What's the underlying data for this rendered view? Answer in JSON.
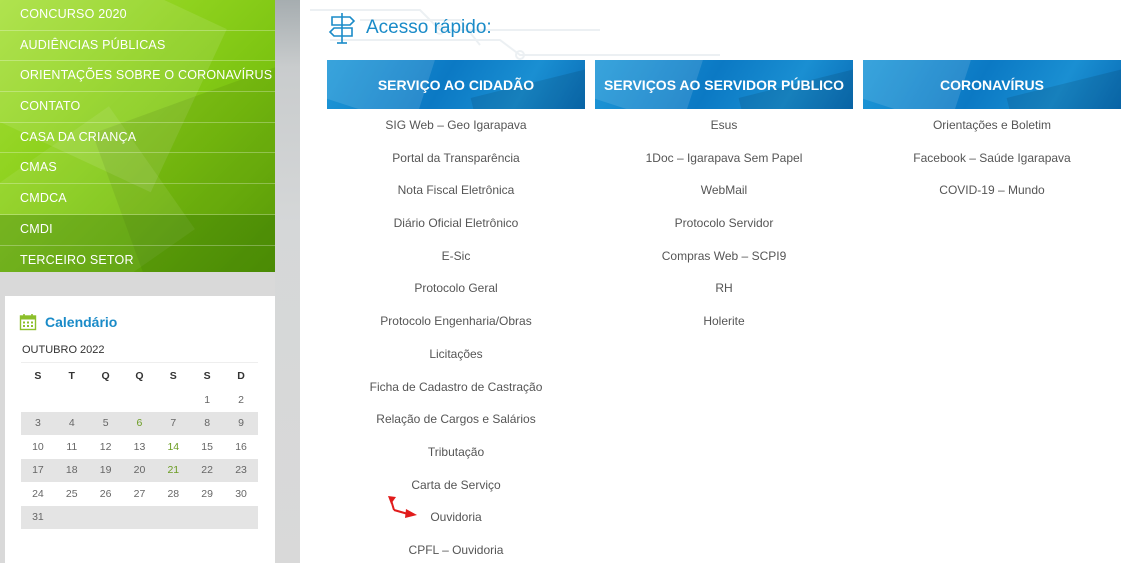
{
  "sidebar": {
    "menu": [
      {
        "label": "CONCURSO 2020"
      },
      {
        "label": "AUDIÊNCIAS PÚBLICAS"
      },
      {
        "label": "ORIENTAÇÕES SOBRE O CORONAVÍRUS"
      },
      {
        "label": "CONTATO"
      },
      {
        "label": "CASA DA CRIANÇA"
      },
      {
        "label": "CMAS"
      },
      {
        "label": "CMDCA"
      },
      {
        "label": "CMDI"
      },
      {
        "label": "TERCEIRO SETOR"
      }
    ],
    "calendar": {
      "title": "Calendário",
      "month": "OUTUBRO 2022",
      "weekdays": [
        "S",
        "T",
        "Q",
        "Q",
        "S",
        "S",
        "D"
      ],
      "weeks": [
        [
          "",
          "",
          "",
          "",
          "",
          "1",
          "2"
        ],
        [
          "3",
          "4",
          "5",
          "6",
          "7",
          "8",
          "9"
        ],
        [
          "10",
          "11",
          "12",
          "13",
          "14",
          "15",
          "16"
        ],
        [
          "17",
          "18",
          "19",
          "20",
          "21",
          "22",
          "23"
        ],
        [
          "24",
          "25",
          "26",
          "27",
          "28",
          "29",
          "30"
        ],
        [
          "31",
          "",
          "",
          "",
          "",
          "",
          ""
        ]
      ],
      "highlight_color": "#6b9c23",
      "event_days": [
        "6",
        "14",
        "21"
      ]
    }
  },
  "quick_access": {
    "title": "Acesso rápido:",
    "columns": [
      {
        "heading": "SERVIÇO AO CIDADÃO",
        "links": [
          "SIG Web – Geo Igarapava",
          "Portal da Transparência",
          "Nota Fiscal Eletrônica",
          "Diário Oficial Eletrônico",
          "E-Sic",
          "Protocolo Geral",
          "Protocolo Engenharia/Obras",
          "Licitações",
          "Ficha de Cadastro de Castração",
          "Relação de Cargos e Salários",
          "Tributação",
          "Carta de Serviço",
          "Ouvidoria",
          "CPFL – Ouvidoria"
        ]
      },
      {
        "heading": "SERVIÇOS AO SERVIDOR PÚBLICO",
        "links": [
          "Esus",
          "1Doc – Igarapava Sem Papel",
          "WebMail",
          "Protocolo Servidor",
          "Compras Web – SCPI9",
          "RH",
          "Holerite"
        ]
      },
      {
        "heading": "CORONAVÍRUS",
        "links": [
          "Orientações e Boletim",
          "Facebook – Saúde Igarapava",
          "COVID-19 – Mundo"
        ]
      }
    ]
  },
  "colors": {
    "accent_blue": "#1a8bc8",
    "menu_green": "#8fd21e",
    "annotation_red": "#e11b1b"
  }
}
